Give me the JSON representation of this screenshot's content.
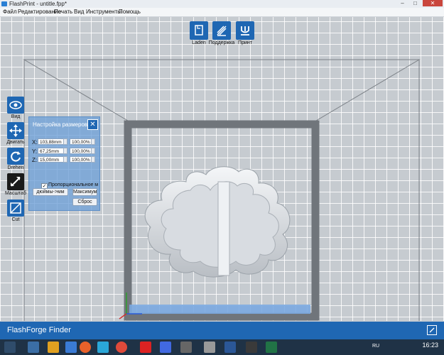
{
  "window": {
    "title": "FlashPrint - untitle.fpp*",
    "min": "–",
    "max": "□",
    "close": "✕"
  },
  "menu": [
    "Файл",
    "Редактирование",
    "Печать",
    "Вид",
    "Инструменты",
    "Помощь"
  ],
  "top_toolbar": [
    {
      "label": "Laden",
      "icon": "file-load-icon"
    },
    {
      "label": "Поддержка",
      "icon": "supports-icon"
    },
    {
      "label": "Принт",
      "icon": "print-icon"
    }
  ],
  "left_tools": [
    {
      "label": "Вид",
      "icon": "eye-icon",
      "active": false
    },
    {
      "label": "Двигать",
      "icon": "move-arrows-icon",
      "active": false
    },
    {
      "label": "Drehen",
      "icon": "rotate-icon",
      "active": false
    },
    {
      "label": "Масштаб",
      "icon": "scale-diagonal-icon",
      "active": true
    },
    {
      "label": "Cut",
      "icon": "cut-icon",
      "active": false
    }
  ],
  "scale_panel": {
    "title": "Настройка размеров",
    "rows": [
      {
        "axis": "X:",
        "size": "103,88mm",
        "percent": "100,00%"
      },
      {
        "axis": "Y:",
        "size": "67,25mm",
        "percent": "100,00%"
      },
      {
        "axis": "Z:",
        "size": "15,00mm",
        "percent": "100,00%"
      }
    ],
    "keep_ratio_checked": true,
    "keep_ratio_label": "Пропорциональное масш",
    "inch_to_mm_button": "дюймы->мм",
    "maximum_button": "Максимум",
    "reset_button": "Сброс"
  },
  "app_bar": {
    "name": "FlashForge Finder"
  },
  "taskbar": {
    "lang": "RU",
    "time": "16:23"
  },
  "colors": {
    "accent": "#1f67b3",
    "taskbar": "#1f3246",
    "panel": "#6ea0d7"
  }
}
